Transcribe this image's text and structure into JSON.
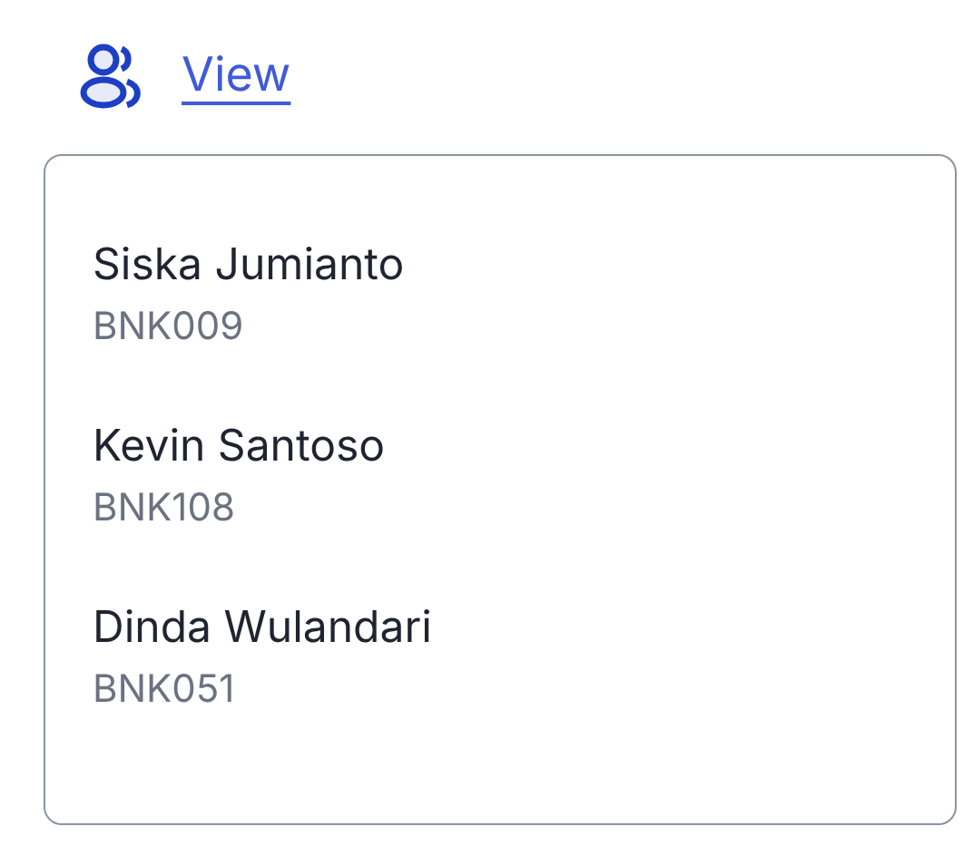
{
  "link": {
    "label": "View"
  },
  "people": [
    {
      "name": "Siska Jumianto",
      "code": "BNK009"
    },
    {
      "name": "Kevin Santoso",
      "code": "BNK108"
    },
    {
      "name": "Dinda Wulandari",
      "code": "BNK051"
    }
  ]
}
